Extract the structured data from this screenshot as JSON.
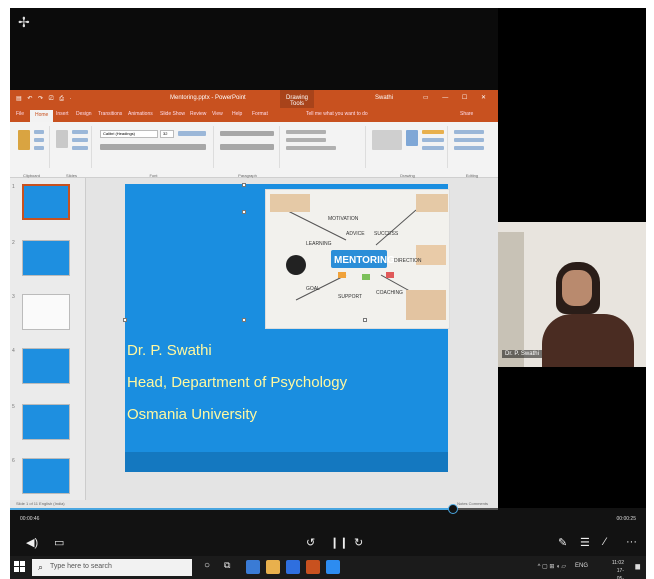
{
  "window": {
    "ppt_title": "Mentoring.pptx - PowerPoint",
    "drawing_tools": "Drawing Tools",
    "user": "Swathi",
    "tell_me": "Tell me what you want to do",
    "share": "Share"
  },
  "tabs": [
    "File",
    "Home",
    "Insert",
    "Design",
    "Transitions",
    "Animations",
    "Slide Show",
    "Review",
    "View",
    "Help",
    "Format"
  ],
  "ribbon_groups": [
    "Clipboard",
    "Slides",
    "Font",
    "Paragraph",
    "Drawing",
    "Editing"
  ],
  "font_box": "Calibri (Headings)",
  "font_size": "32",
  "slide": {
    "name": "Dr. P. Swathi",
    "department": "Head, Department of Psychology",
    "university": "Osmania University",
    "image_words": [
      "MOTIVATION",
      "ADVICE",
      "LEARNING",
      "SUCCESS",
      "MENTORING",
      "DIRECTION",
      "GOAL",
      "SUPPORT",
      "COACHING"
    ]
  },
  "thumbnails": [
    "1",
    "2",
    "3",
    "4",
    "5",
    "6"
  ],
  "status": {
    "left": "Slide 1 of 11   English (India)",
    "right": "Notes   Comments"
  },
  "webcam": {
    "label": "Dr. P. Swathi"
  },
  "meeting": {
    "left_text": "00:00:46",
    "right_text": "00:00:25"
  },
  "taskbar": {
    "search_placeholder": "Type here to search",
    "time": "11:02",
    "date": "17-05-2021",
    "lang": "ENG"
  }
}
